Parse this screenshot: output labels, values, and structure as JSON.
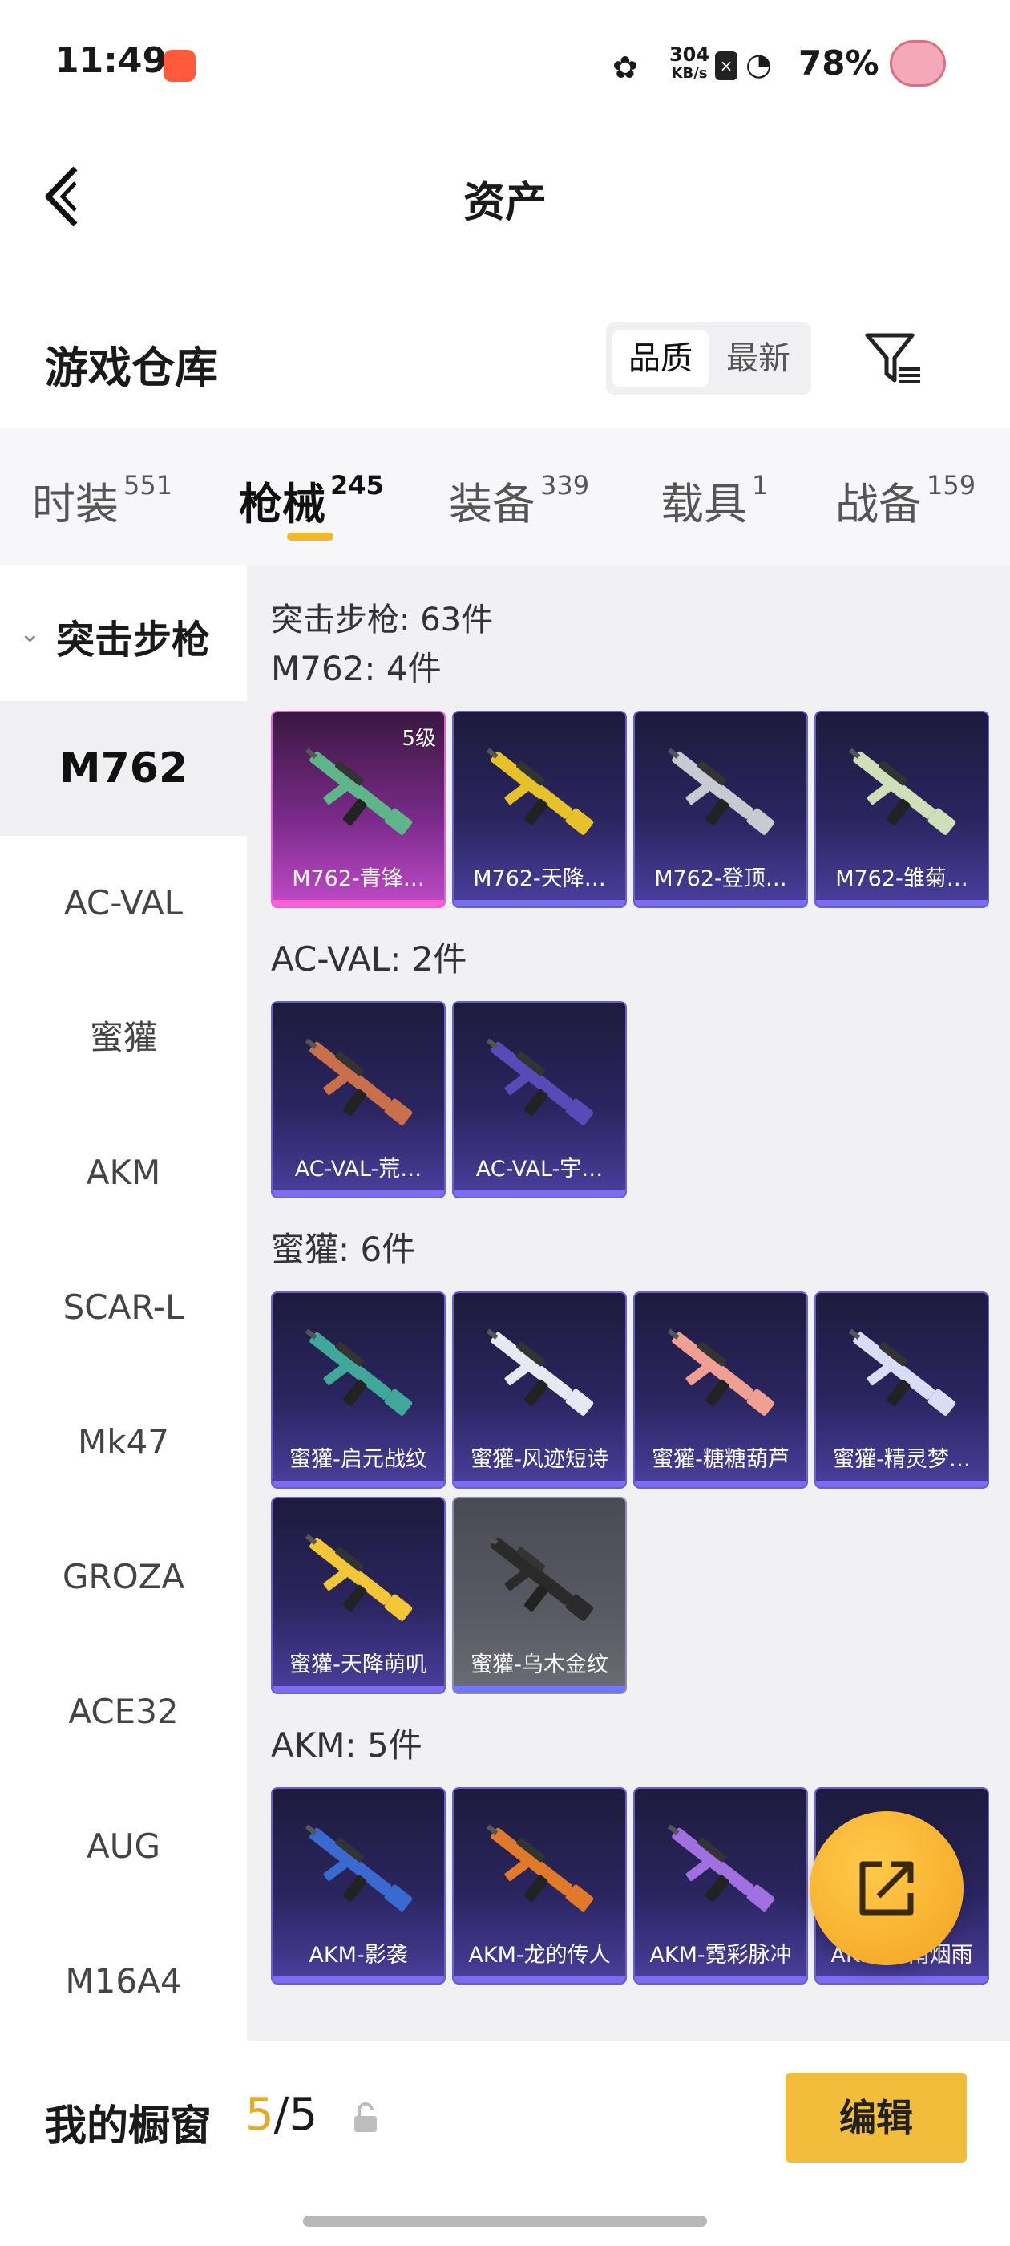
{
  "status": {
    "time": "11:49",
    "speed_value": "304",
    "speed_unit": "KB/s",
    "battery": "78%"
  },
  "header": {
    "title": "资产"
  },
  "warehouse": {
    "title": "游戏仓库",
    "sort_options": [
      "品质",
      "最新"
    ],
    "selected_sort": "品质"
  },
  "tabs": [
    {
      "label": "时装",
      "count": "551"
    },
    {
      "label": "枪械",
      "count": "245"
    },
    {
      "label": "装备",
      "count": "339"
    },
    {
      "label": "载具",
      "count": "1"
    },
    {
      "label": "战备",
      "count": "159"
    }
  ],
  "active_tab": "枪械",
  "sidebar": {
    "category": "突击步枪",
    "items": [
      "M762",
      "AC-VAL",
      "蜜獾",
      "AKM",
      "SCAR-L",
      "Mk47",
      "GROZA",
      "ACE32",
      "AUG",
      "M16A4"
    ],
    "active_item": "M762"
  },
  "content": {
    "total": "突击步枪: 63件",
    "groups": [
      {
        "title": "M762: 4件",
        "items": [
          {
            "name": "M762-青锋…",
            "level": "5级",
            "style": "pink",
            "gun": "#5fb58a"
          },
          {
            "name": "M762-天降…",
            "style": "blue",
            "gun": "#e6c12a"
          },
          {
            "name": "M762-登顶…",
            "style": "blue",
            "gun": "#c9c9d2"
          },
          {
            "name": "M762-雏菊…",
            "style": "blue",
            "gun": "#cfe0b8"
          }
        ]
      },
      {
        "title": "AC-VAL: 2件",
        "items": [
          {
            "name": "AC-VAL-荒…",
            "style": "blue",
            "gun": "#c9704a"
          },
          {
            "name": "AC-VAL-宇…",
            "style": "blue",
            "gun": "#5a4ab8"
          }
        ]
      },
      {
        "title": "蜜獾: 6件",
        "items": [
          {
            "name": "蜜獾-启元战纹",
            "style": "blue",
            "gun": "#3fa89a"
          },
          {
            "name": "蜜獾-风迹短诗",
            "style": "blue",
            "gun": "#e8e8f2"
          },
          {
            "name": "蜜獾-糖糖葫芦",
            "style": "blue",
            "gun": "#f0a090"
          },
          {
            "name": "蜜獾-精灵梦…",
            "style": "blue",
            "gun": "#d8dcf4"
          },
          {
            "name": "蜜獾-天降萌叽",
            "style": "blue",
            "gun": "#f2c636"
          },
          {
            "name": "蜜獾-乌木金纹",
            "style": "gray",
            "gun": "#2a2a2a"
          }
        ]
      },
      {
        "title": "AKM: 5件",
        "items": [
          {
            "name": "AKM-影袭",
            "style": "blue",
            "gun": "#3a6ad0"
          },
          {
            "name": "AKM-龙的传人",
            "style": "blue",
            "gun": "#e07a2a"
          },
          {
            "name": "AKM-霓彩脉冲",
            "style": "blue",
            "gun": "#a070e0"
          },
          {
            "name": "AKM-江南烟雨",
            "style": "blue",
            "gun": "#8fb0c0"
          }
        ]
      }
    ]
  },
  "bottom": {
    "showcase_label": "我的橱窗",
    "current": "5",
    "separator": "/",
    "max": "5",
    "edit_label": "编辑"
  },
  "colors": {
    "accent": "#f3bd3c",
    "card_blue": "#2b2560",
    "card_pink": "#7a2a8a"
  }
}
